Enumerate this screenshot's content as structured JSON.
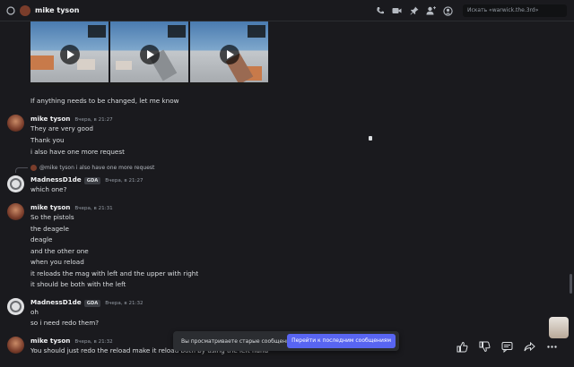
{
  "header": {
    "title": "mike tyson",
    "search_placeholder": "Искать «warwick.the.3rd»",
    "icons": [
      "phone-icon",
      "video-icon",
      "pin-icon",
      "add-friend-icon",
      "profile-icon"
    ]
  },
  "messages": [
    {
      "id": "m0",
      "text": "If anything needs to be changed, let me know"
    },
    {
      "id": "m1",
      "author": "mike tyson",
      "time": "Вчера, в 21:27",
      "lines": [
        "They are very good",
        "Thank you",
        "i also have one more request"
      ]
    },
    {
      "id": "m2",
      "author": "MadnessD1de",
      "tag": "GDA",
      "time": "Вчера, в 21:27",
      "reply": {
        "author": "@mike tyson",
        "text": "i also have one more request"
      },
      "lines": [
        "which one?"
      ]
    },
    {
      "id": "m3",
      "author": "mike tyson",
      "time": "Вчера, в 21:31",
      "lines": [
        "So the pistols",
        "the deagele",
        "deagle",
        "and the other one",
        "when you reload",
        "it reloads the mag with left and the upper with right",
        "it should be both with the left"
      ]
    },
    {
      "id": "m4",
      "author": "MadnessD1de",
      "tag": "GDA",
      "time": "Вчера, в 21:32",
      "lines": [
        "oh",
        "so i need redo them?"
      ]
    },
    {
      "id": "m5",
      "author": "mike tyson",
      "time": "Вчера, в 21:32",
      "lines": [
        "You should just redo the reload make it reload both by using the left hand"
      ]
    }
  ],
  "banner": {
    "text": "Вы просматриваете старые сообщения",
    "button": "Перейти к последним сообщениям"
  },
  "message_actions": [
    "thumbs-up-icon",
    "thumbs-down-icon",
    "reply-icon",
    "forward-icon",
    "more-icon"
  ]
}
